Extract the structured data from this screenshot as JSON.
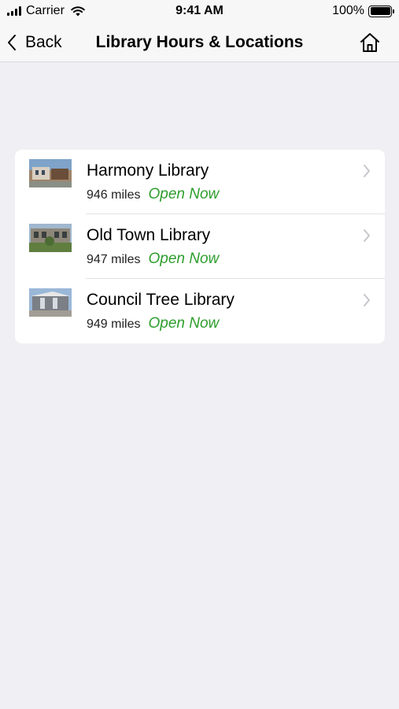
{
  "status_bar": {
    "carrier": "Carrier",
    "time": "9:41 AM",
    "battery": "100%"
  },
  "nav": {
    "back_label": "Back",
    "title": "Library Hours & Locations",
    "home_icon": "home-icon"
  },
  "libraries": [
    {
      "name": "Harmony Library",
      "distance": "946 miles",
      "status": "Open Now"
    },
    {
      "name": "Old Town Library",
      "distance": "947 miles",
      "status": "Open Now"
    },
    {
      "name": "Council Tree Library",
      "distance": "949 miles",
      "status": "Open Now"
    }
  ],
  "colors": {
    "background": "#efeff4",
    "open_status": "#2e9e2e",
    "chevron": "#c7c7cc"
  }
}
